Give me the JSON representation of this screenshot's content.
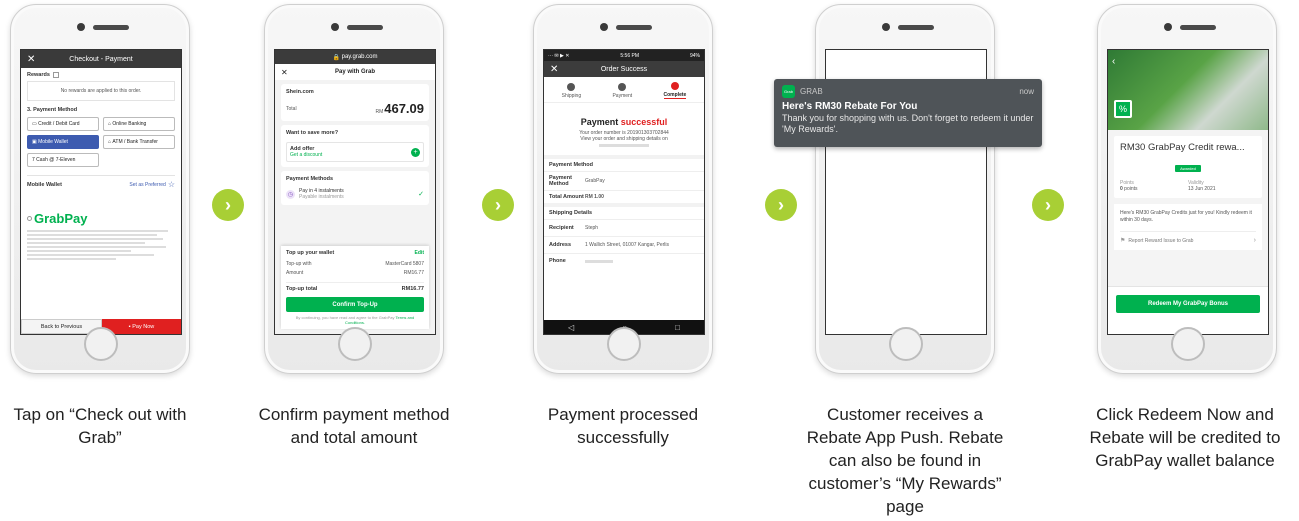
{
  "steps": [
    {
      "caption": "Tap on “Check out with Grab”",
      "screen": {
        "title": "Checkout - Payment",
        "rewards_label": "Rewards",
        "rewards_note": "No rewards are applied to this order.",
        "payment_method_label": "3. Payment Method",
        "methods": [
          "Credit / Debit Card",
          "Online Banking",
          "Mobile Wallet",
          "ATM / Bank Transfer",
          "Cash @ 7-Eleven"
        ],
        "mobile_wallet_label": "Mobile Wallet",
        "set_preferred": "Set as Preferred",
        "grabpay_logo": "GrabPay",
        "back_button": "Back to Previous",
        "pay_button": "Pay Now"
      }
    },
    {
      "caption": "Confirm payment method and total  amount",
      "screen": {
        "url": "pay.grab.com",
        "header": "Pay with Grab",
        "merchant": "Shein.com",
        "total_label": "Total",
        "currency": "RM",
        "amount": "467.09",
        "save_more": "Want to save more?",
        "add_offer": "Add offer",
        "add_offer_sub": "Get a discount",
        "payment_methods": "Payment Methods",
        "pay_in_4": "Pay in 4 instalments",
        "pay_in_4_sub": "Payable instalments",
        "top_up_title": "Top up your wallet",
        "edit": "Edit",
        "top_up_with": "Top-up with",
        "top_up_with_value": "MasterCard 5807",
        "amount_label": "Amount",
        "amount_value": "RM16.77",
        "top_up_total": "Top-up total",
        "top_up_total_value": "RM16.77",
        "confirm_button": "Confirm Top-Up",
        "terms_prefix": "By continuing, you have read and agree to the GrabPay",
        "terms_link": "Terms and Conditions."
      }
    },
    {
      "caption": "Payment processed successfully",
      "screen": {
        "status_time": "5:56 PM",
        "status_battery": "94%",
        "title": "Order Success",
        "steps": [
          "Shipping",
          "Payment",
          "Complete"
        ],
        "payment_word": "Payment",
        "successful_word": "successful",
        "order_number_text": "Your order number is 201901303702844",
        "view_text": "View your order and shipping details on",
        "payment_method_header": "Payment Method",
        "pm_label": "Payment Method",
        "pm_value": "GrabPay",
        "total_label": "Total Amount",
        "total_value": "RM 1.00",
        "shipping_header": "Shipping Details",
        "recipient_label": "Recipient",
        "recipient_value": "Steph",
        "address_label": "Address",
        "address_value": "1 Wallich Street, 01007 Kangar, Perlis",
        "phone_label": "Phone"
      }
    },
    {
      "caption": "Customer receives a Rebate App Push. Rebate can also be found in customer’s “My Rewards” page",
      "screen": {
        "app_icon": "Grab",
        "app_name": "GRAB",
        "time": "now",
        "title": "Here's RM30 Rebate For You",
        "body": "Thank you for shopping with us. Don't forget to redeem it under 'My Rewards'."
      }
    },
    {
      "caption": "Click Redeem Now and Rebate will be credited to GrabPay wallet balance",
      "screen": {
        "reward_title": "RM30 GrabPay Credit rewa...",
        "badge": "Awarded",
        "points_label": "Points",
        "points_value": "0",
        "points_unit": "points",
        "validity_label": "Validity",
        "validity_value": "13 Jun 2021",
        "description": "Here's RM30 GrabPay Credits just for you! Kindly redeem it within 30 days.",
        "report_link": "Report Reward Issue to Grab",
        "redeem_button": "Redeem My GrabPay Bonus"
      }
    }
  ],
  "colors": {
    "accent": "#a8cf35",
    "grab_green": "#00b14f",
    "red": "#e02020",
    "dark_bar": "#2e2e2e"
  }
}
